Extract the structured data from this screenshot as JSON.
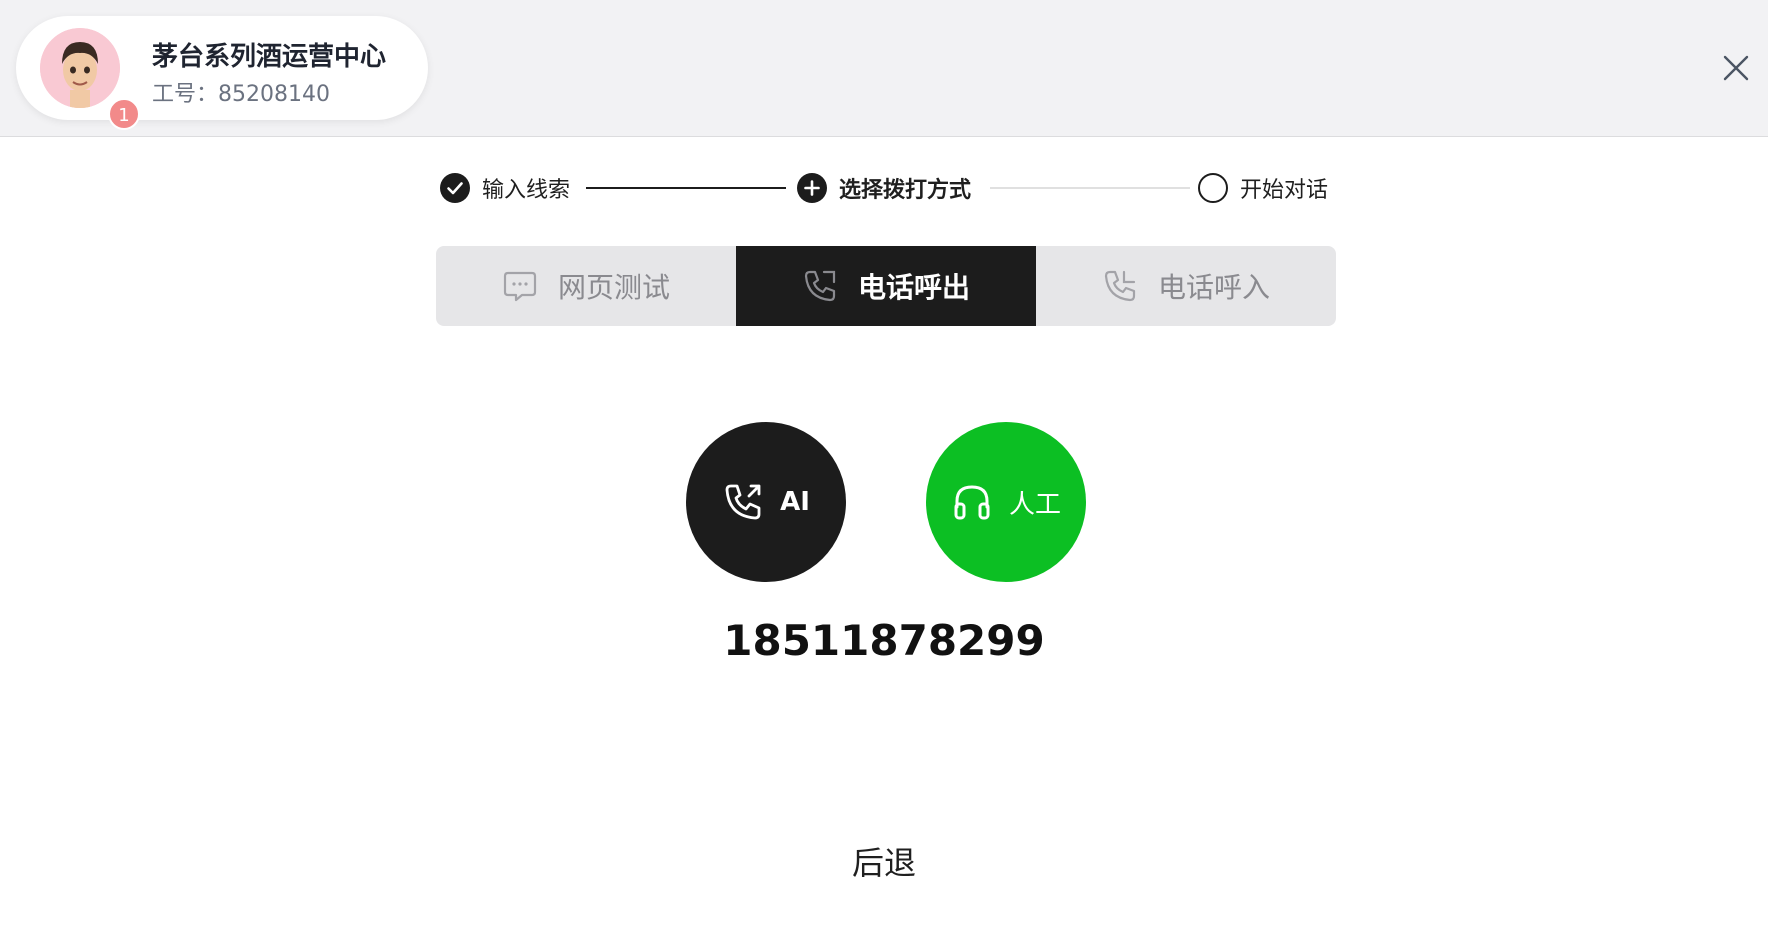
{
  "header": {
    "org_name": "茅台系列酒运营中心",
    "staff_id": "工号：85208140",
    "badge_count": "1",
    "avatar_icon": "memoji-avatar-icon",
    "close_icon": "close-icon"
  },
  "stepper": {
    "steps": [
      {
        "label": "输入线索",
        "state": "done"
      },
      {
        "label": "选择拨打方式",
        "state": "current"
      },
      {
        "label": "开始对话",
        "state": "pending"
      }
    ]
  },
  "tabs": [
    {
      "label": "网页测试",
      "icon": "chat-bubble-icon",
      "active": false
    },
    {
      "label": "电话呼出",
      "icon": "phone-outgoing-icon",
      "active": true
    },
    {
      "label": "电话呼入",
      "icon": "phone-incoming-icon",
      "active": false
    }
  ],
  "call_options": {
    "ai": {
      "label": "AI",
      "icon": "phone-outgoing-icon",
      "color": "#1c1c1c"
    },
    "human": {
      "label": "人工",
      "icon": "headset-icon",
      "color": "#0cbf23"
    }
  },
  "phone_number": "18511878299",
  "back_label": "后退"
}
